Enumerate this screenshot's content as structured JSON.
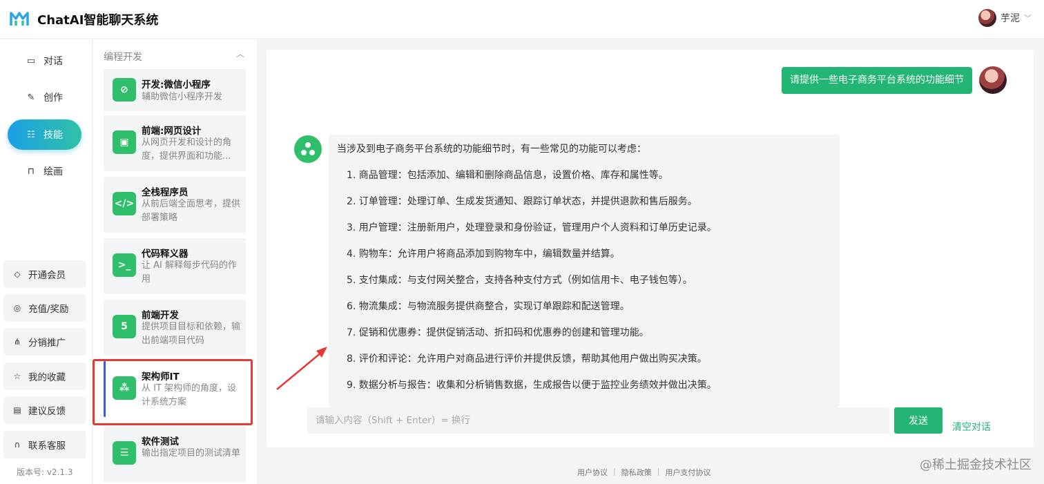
{
  "header": {
    "app_title": "ChatAI智能聊天系统",
    "user_name": "芋泥"
  },
  "nav": [
    {
      "label": "对话",
      "icon": "chat-icon"
    },
    {
      "label": "创作",
      "icon": "pen-icon"
    },
    {
      "label": "技能",
      "icon": "skill-icon",
      "active": true
    },
    {
      "label": "绘画",
      "icon": "brush-icon"
    }
  ],
  "side_buttons": [
    {
      "label": "开通会员",
      "icon": "diamond-icon"
    },
    {
      "label": "充值/奖励",
      "icon": "coin-icon"
    },
    {
      "label": "分销推广",
      "icon": "share-icon"
    },
    {
      "label": "我的收藏",
      "icon": "star-icon"
    },
    {
      "label": "建议反馈",
      "icon": "feedback-icon"
    },
    {
      "label": "联系客服",
      "icon": "headset-icon"
    }
  ],
  "version": "版本号: v2.1.3",
  "skills": {
    "group_title": "编程开发",
    "items": [
      {
        "title": "开发:微信小程序",
        "desc": "辅助微信小程序开发"
      },
      {
        "title": "前端:网页设计",
        "desc": "从网页开发和设计的角度，提供界面和功能..."
      },
      {
        "title": "全栈程序员",
        "desc": "从前后端全面思考，提供部署策略"
      },
      {
        "title": "代码释义器",
        "desc": "让 AI 解释每步代码的作用"
      },
      {
        "title": "前端开发",
        "desc": "提供项目目标和依赖，输出前端项目代码"
      },
      {
        "title": "架构师IT",
        "desc": "从 IT 架构师的角度，设计系统方案",
        "selected": true
      },
      {
        "title": "软件测试",
        "desc": "输出指定项目的测试清单"
      }
    ]
  },
  "chat": {
    "user_message": "请提供一些电子商务平台系统的功能细节",
    "bot_intro": "当涉及到电子商务平台系统的功能细节时，有一些常见的功能可以考虑：",
    "bot_points": [
      "1. 商品管理：包括添加、编辑和删除商品信息，设置价格、库存和属性等。",
      "2. 订单管理：处理订单、生成发货通知、跟踪订单状态，并提供退款和售后服务。",
      "3. 用户管理：注册新用户，处理登录和身份验证，管理用户个人资料和订单历史记录。",
      "4. 购物车：允许用户将商品添加到购物车中，编辑数量并结算。",
      "5. 支付集成：与支付网关整合，支持各种支付方式（例如信用卡、电子钱包等）。",
      "6. 物流集成：与物流服务提供商整合，实现订单跟踪和配送管理。",
      "7. 促销和优惠券：提供促销活动、折扣码和优惠券的创建和管理功能。",
      "8. 评价和评论：允许用户对商品进行评价并提供反馈，帮助其他用户做出购买决策。",
      "9. 数据分析与报告：收集和分析销售数据，生成报告以便于监控业务绩效并做出决策。"
    ],
    "input_placeholder": "请输入内容（Shift + Enter）= 换行",
    "send_label": "发送",
    "clear_label": "清空对话"
  },
  "footer": {
    "links": [
      "用户协议",
      "隐私政策",
      "用户支付协议"
    ]
  },
  "watermark": "@稀土掘金技术社区",
  "colors": {
    "accent": "#22b573",
    "nav_active_start": "#1aa0e6",
    "nav_active_end": "#2fc2a6",
    "highlight_box": "#e53935"
  }
}
